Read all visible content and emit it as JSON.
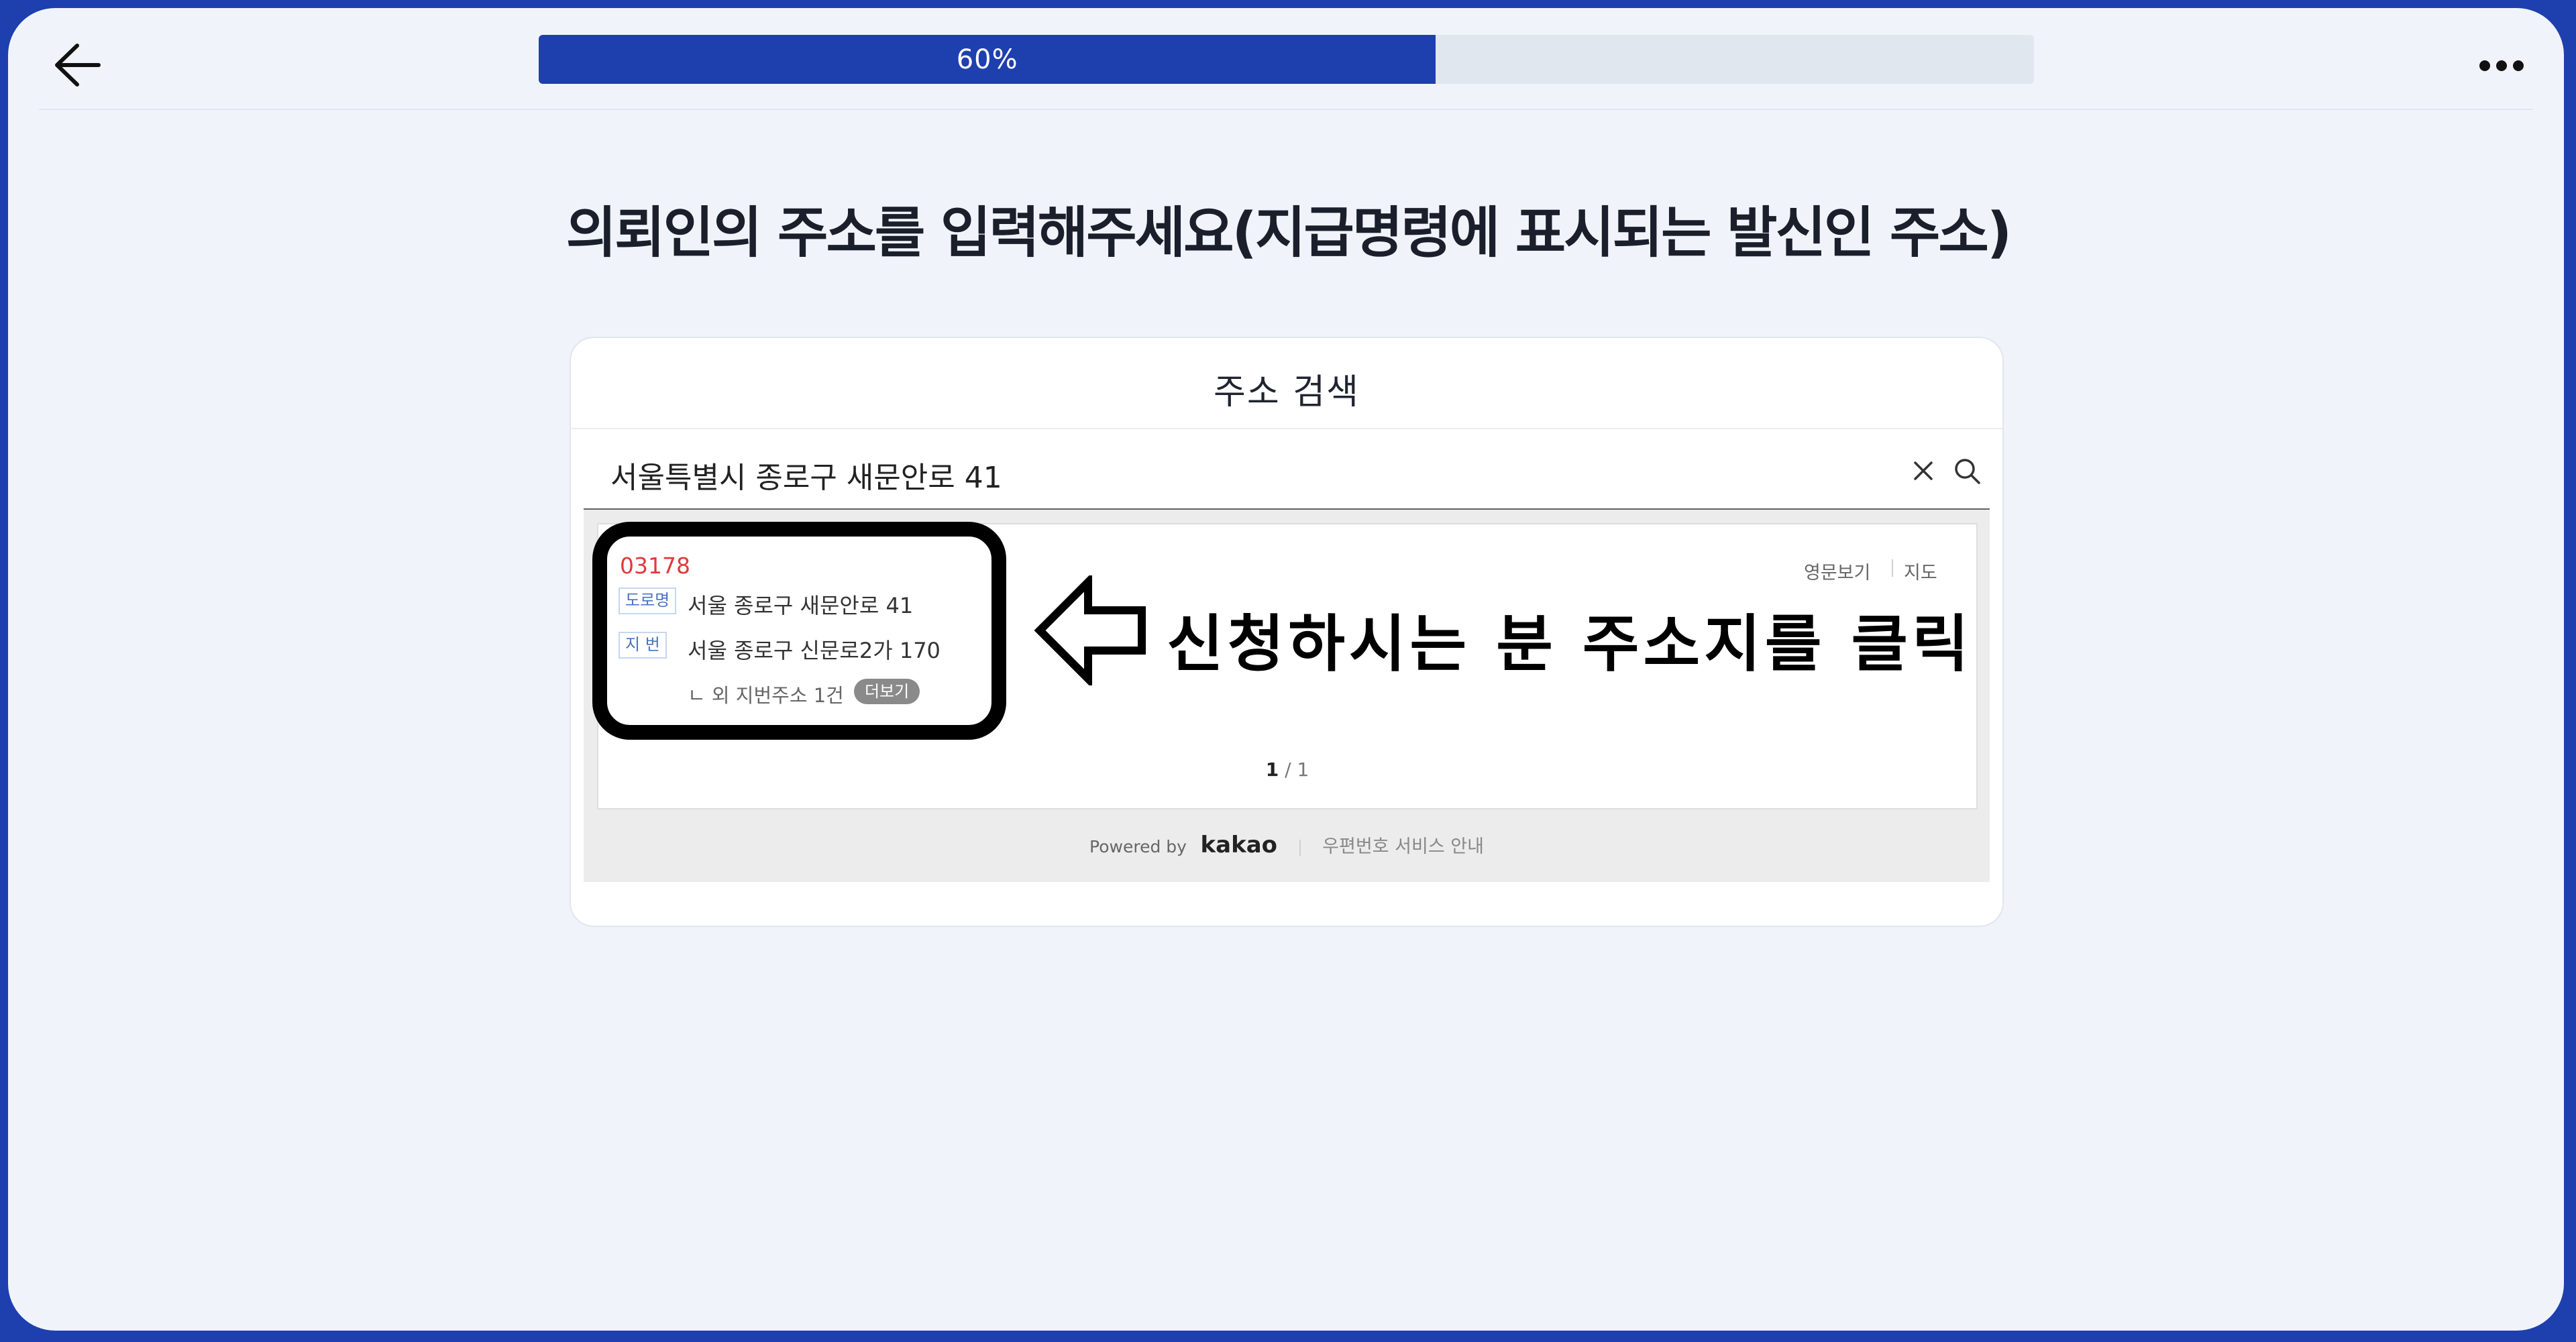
{
  "header": {
    "progress_label": "60%",
    "progress_value": 0.6
  },
  "page": {
    "title": "의뢰인의 주소를 입력해주세요(지급명령에 표시되는 발신인 주소)"
  },
  "address_search": {
    "title": "주소 검색",
    "query": "서울특별시 종로구 새문안로 41",
    "result": {
      "zipcode": "03178",
      "road_tag": "도로명",
      "road_address": "서울 종로구 새문안로 41",
      "jibun_tag": "지 번",
      "jibun_address": "서울 종로구 신문로2가 170",
      "extra_note": "ㄴ 외 지번주소 1건",
      "more_label": "더보기",
      "english_link": "영문보기",
      "map_link": "지도"
    },
    "pagination": {
      "current": "1",
      "separator": "/",
      "total": "1"
    },
    "footer": {
      "powered_by": "Powered by",
      "brand": "kakao",
      "service_guide": "우편번호 서비스 안내"
    }
  },
  "annotation": {
    "text": "신청하시는 분 주소지를 클릭"
  },
  "colors": {
    "brand_blue": "#1e3fae",
    "zipcode_red": "#e03a3a",
    "page_bg": "#f0f4fa"
  },
  "icons": {
    "back": "arrow-left-icon",
    "more": "more-horizontal-icon",
    "clear": "close-icon",
    "search": "search-icon",
    "callout_arrow": "arrow-left-outline-icon"
  }
}
